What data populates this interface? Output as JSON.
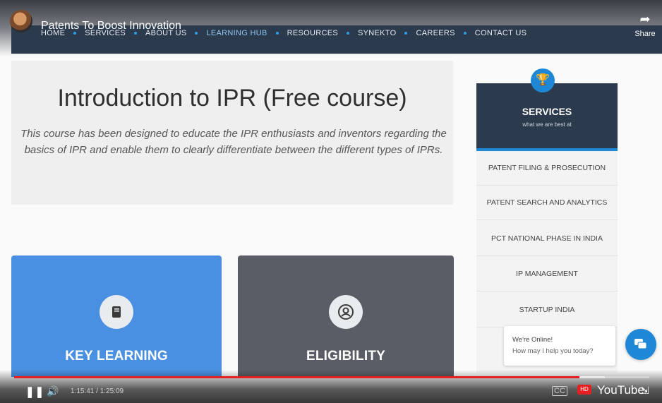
{
  "video": {
    "title": "Patents To Boost Innovation",
    "share_label": "Share",
    "time_display": "1:15:41 / 1:25:09",
    "progress": 0.89,
    "loaded": 0.93,
    "platform": "YouTube"
  },
  "nav": {
    "items": [
      {
        "label": "HOME"
      },
      {
        "label": "SERVICES"
      },
      {
        "label": "ABOUT US"
      },
      {
        "label": "LEARNING HUB"
      },
      {
        "label": "RESOURCES"
      },
      {
        "label": "SYNEKTO"
      },
      {
        "label": "CAREERS"
      },
      {
        "label": "CONTACT US"
      }
    ],
    "active": "LEARNING HUB"
  },
  "intro": {
    "title": "Introduction to IPR (Free course)",
    "description": "This course has been designed to educate the IPR enthusiasts and inventors regarding the basics of IPR and enable them to clearly differentiate between the different types of IPRs."
  },
  "cards": [
    {
      "title": "KEY LEARNING",
      "icon": "book-icon",
      "color": "#4a90e2"
    },
    {
      "title": "ELIGIBILITY",
      "icon": "user-icon",
      "color": "#5a5d66"
    }
  ],
  "services": {
    "title": "SERVICES",
    "subtitle": "what we are best at",
    "items": [
      "PATENT FILING & PROSECUTION",
      "PATENT SEARCH AND ANALYTICS",
      "PCT NATIONAL PHASE IN INDIA",
      "IP MANAGEMENT",
      "STARTUP INDIA"
    ]
  },
  "chat": {
    "line1": "We're Online!",
    "line2": "How may I help you today?"
  },
  "colors": {
    "accent": "#1e88d6",
    "nav_bg": "#2c3a4e",
    "progress": "#e52020"
  }
}
